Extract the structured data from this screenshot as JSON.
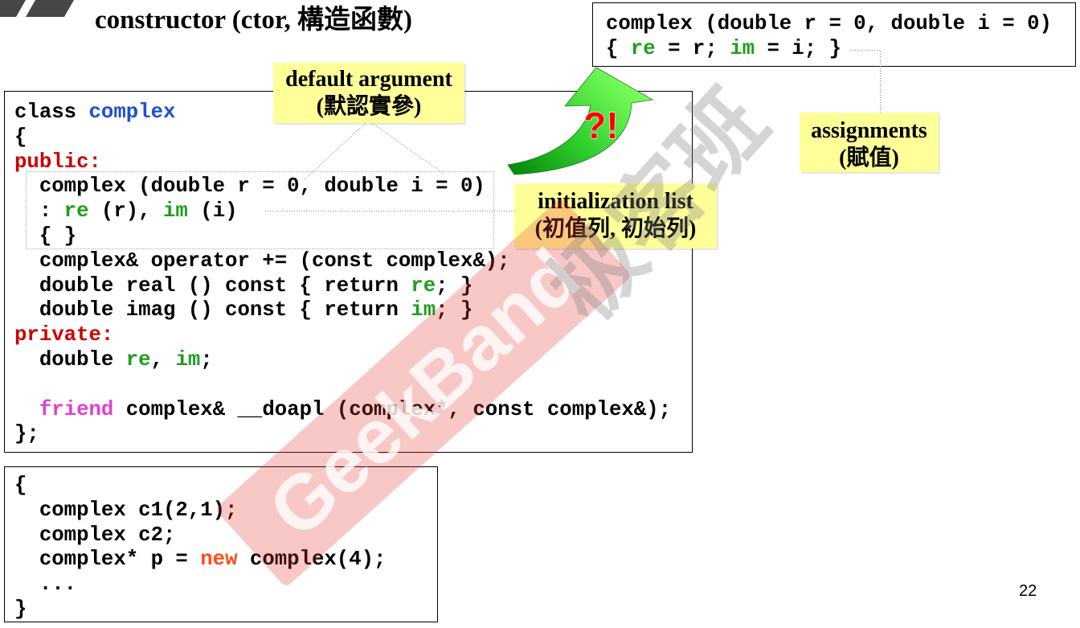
{
  "slide": {
    "title": "constructor (ctor, 構造函數)",
    "page_number": "22"
  },
  "assignment_code": {
    "lines": [
      [
        {
          "t": "complex (double r = 0, double i = 0)"
        }
      ],
      [
        {
          "t": "{ "
        },
        {
          "t": "re",
          "color": "#1e9e1e"
        },
        {
          "t": " = r; "
        },
        {
          "t": "im",
          "color": "#1e9e1e"
        },
        {
          "t": " = i; }"
        }
      ]
    ]
  },
  "class_code": {
    "lines": [
      [
        {
          "t": "class "
        },
        {
          "t": "complex",
          "color": "#1f4fd0"
        }
      ],
      [
        {
          "t": "{"
        }
      ],
      [
        {
          "t": "public:",
          "color": "#cc0000"
        }
      ],
      [
        {
          "t": "  complex (double r = 0, double i = 0)"
        }
      ],
      [
        {
          "t": "  : "
        },
        {
          "t": "re",
          "color": "#1e9e1e"
        },
        {
          "t": " (r), "
        },
        {
          "t": "im",
          "color": "#1e9e1e"
        },
        {
          "t": " (i)"
        }
      ],
      [
        {
          "t": "  { }"
        }
      ],
      [
        {
          "t": "  complex& operator += (const complex&);"
        }
      ],
      [
        {
          "t": "  double real () const { return "
        },
        {
          "t": "re",
          "color": "#1e9e1e"
        },
        {
          "t": "; }"
        }
      ],
      [
        {
          "t": "  double imag () const { return "
        },
        {
          "t": "im",
          "color": "#1e9e1e"
        },
        {
          "t": "; }"
        }
      ],
      [
        {
          "t": "private:",
          "color": "#cc0000"
        }
      ],
      [
        {
          "t": "  double "
        },
        {
          "t": "re",
          "color": "#1e9e1e"
        },
        {
          "t": ", "
        },
        {
          "t": "im",
          "color": "#1e9e1e"
        },
        {
          "t": ";"
        }
      ],
      [],
      [
        {
          "t": "  "
        },
        {
          "t": "friend",
          "color": "#e23fcf"
        },
        {
          "t": " complex& __doapl (complex*, const complex&);"
        }
      ],
      [
        {
          "t": "};"
        }
      ]
    ]
  },
  "usage_code": {
    "lines": [
      [
        {
          "t": "{"
        }
      ],
      [
        {
          "t": "  complex c1(2,1);"
        }
      ],
      [
        {
          "t": "  complex c2;"
        }
      ],
      [
        {
          "t": "  complex* p = "
        },
        {
          "t": "new",
          "color": "#ff4d1a"
        },
        {
          "t": " complex(4);"
        }
      ],
      [
        {
          "t": "  ..."
        }
      ],
      [
        {
          "t": "}"
        }
      ]
    ]
  },
  "callouts": {
    "default_argument": {
      "line1": "default argument",
      "line2": "(默認實參)"
    },
    "initialization_list": {
      "line1": "initialization list",
      "line2": "(初值列, 初始列)"
    },
    "assignments": {
      "line1": "assignments",
      "line2": "(賦值)"
    }
  },
  "arrow": {
    "icon": "curved-up-arrow",
    "label": "?!"
  },
  "watermark": {
    "latin": "GeekBand",
    "chinese": "极客班"
  },
  "colors": {
    "callout_background": "#ffff99",
    "arrow_light": "#7dff5c",
    "arrow_mid": "#2fcf2f",
    "arrow_dark": "#0a8c0a",
    "arrow_label": "#ff0000",
    "watermark_band": "#e53935",
    "watermark_chinese": "#808080"
  }
}
